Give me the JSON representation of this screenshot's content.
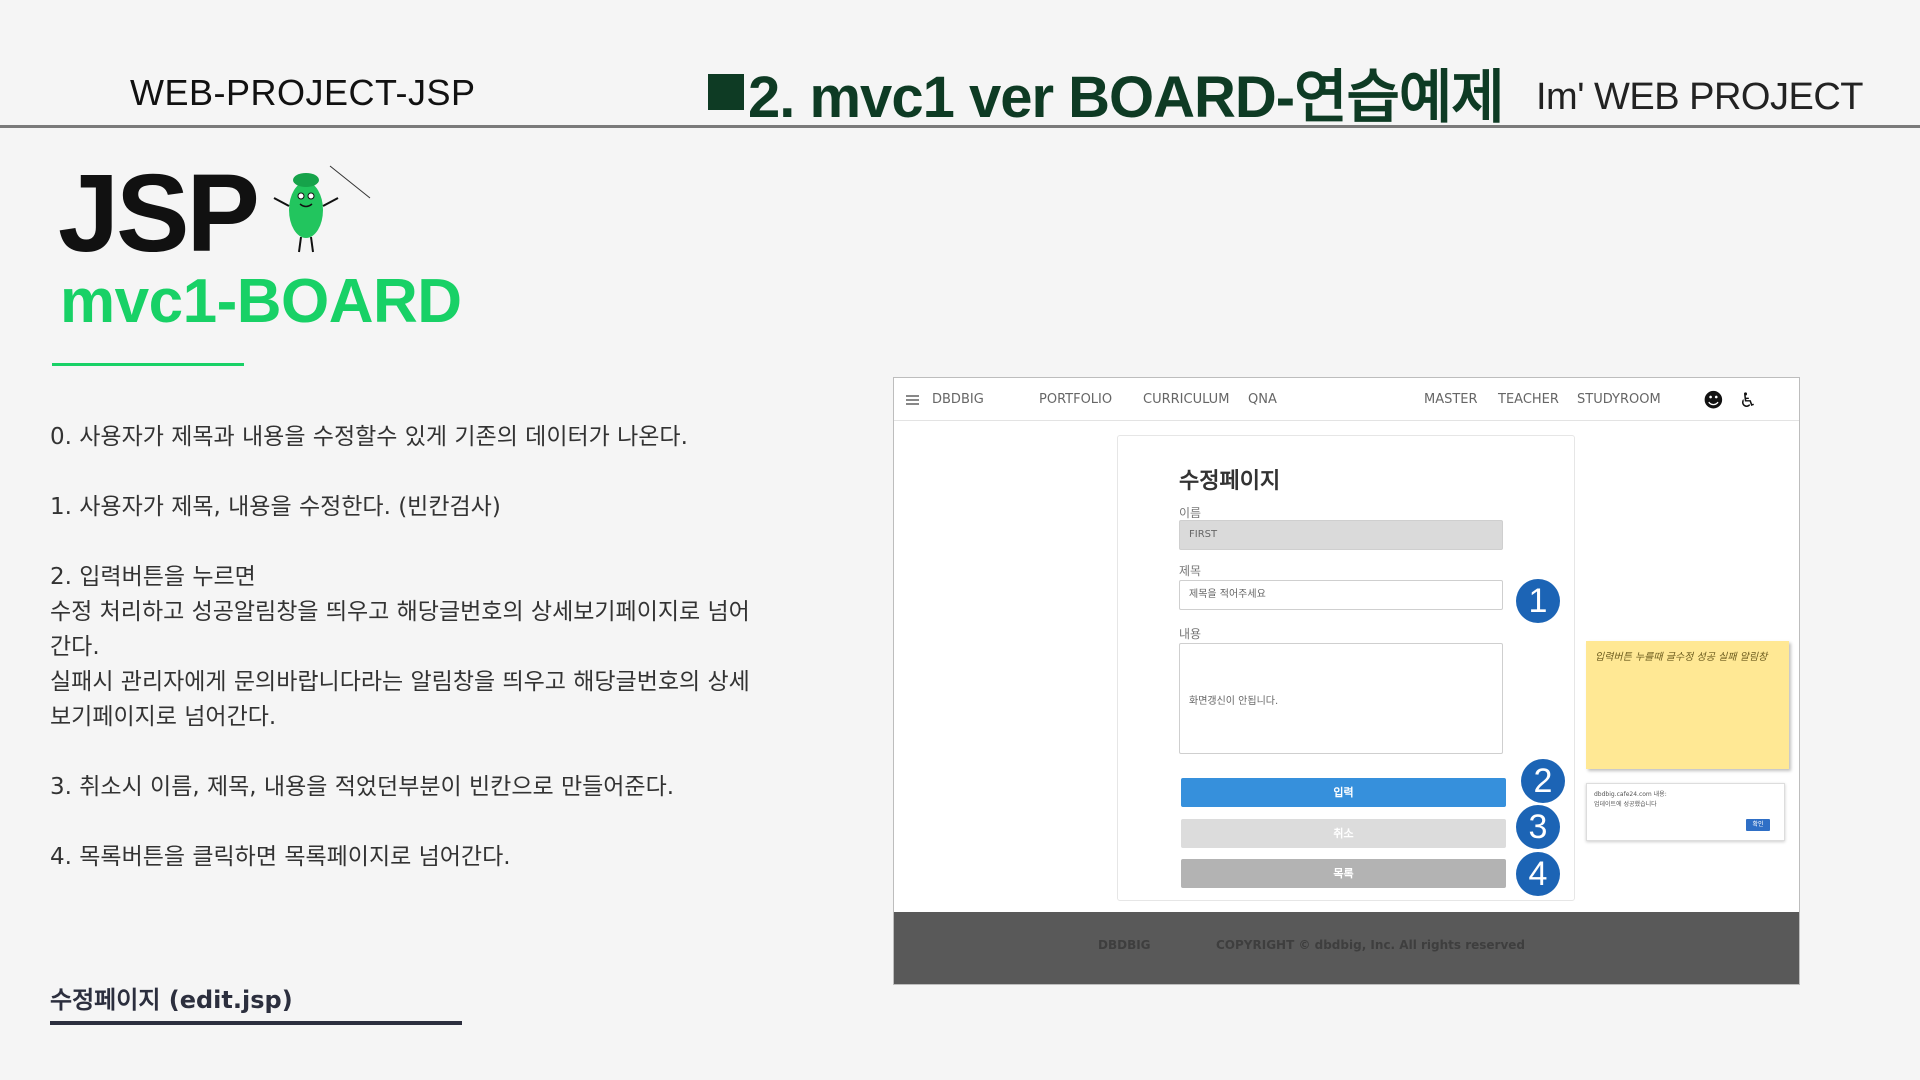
{
  "header": {
    "left": "WEB-PROJECT-JSP",
    "center": "2. mvc1 ver  BOARD-연습예제",
    "right": "Im'  WEB PROJECT"
  },
  "logo": {
    "jsp": "JSP",
    "subtitle": "mvc1-BOARD"
  },
  "description": [
    "0. 사용자가 제목과 내용을 수정할수 있게 기존의 데이터가 나온다.",
    "1. 사용자가  제목, 내용을 수정한다. (빈칸검사)",
    "2. 입력버튼을 누르면\n수정 처리하고  성공알림창을 띄우고 해당글번호의 상세보기페이지로 넘어간다.\n실패시  관리자에게 문의바랍니다라는 알림창을 띄우고 해당글번호의 상세보기페이지로 넘어간다.",
    "3. 취소시 이름, 제목, 내용을 적었던부분이 빈칸으로  만들어준다.",
    "4. 목록버튼을 클릭하면 목록페이지로 넘어간다."
  ],
  "footer_title": "수정페이지  (edit.jsp)",
  "screenshot": {
    "nav": {
      "brand": "DBDBIG",
      "items": [
        "PORTFOLIO",
        "CURRICULUM",
        "QNA"
      ],
      "right_items": [
        "MASTER",
        "TEACHER",
        "STUDYROOM"
      ],
      "icons": [
        "menu-icon",
        "face-icon",
        "accessibility-icon"
      ]
    },
    "form": {
      "title": "수정페이지",
      "name_label": "이름",
      "name_value": "FIRST",
      "subject_label": "제목",
      "subject_placeholder": "제목을 적어주세요",
      "content_label": "내용",
      "content_value": "화면갱신이 안됩니다.",
      "submit_label": "입력",
      "cancel_label": "취소",
      "list_label": "목록",
      "submit_color": "#3690dc",
      "cancel_color": "#dcdcdc",
      "list_color": "#b3b3b3"
    },
    "markers": [
      "1",
      "2",
      "3",
      "4"
    ],
    "note": "입력버튼 누를때 글수정 성공 실패 알림창",
    "alert": {
      "line1": "dbdbig.cafe24.com 내용:",
      "line2": "업데이트에 성공했습니다",
      "ok": "확인"
    },
    "footer": {
      "brand": "DBDBIG",
      "copyright": "COPYRIGHT © dbdbig, Inc. All rights reserved"
    }
  },
  "colors": {
    "brand_green": "#18d166",
    "header_dark_green": "#0e3b24",
    "marker_blue": "#1c64b5"
  }
}
